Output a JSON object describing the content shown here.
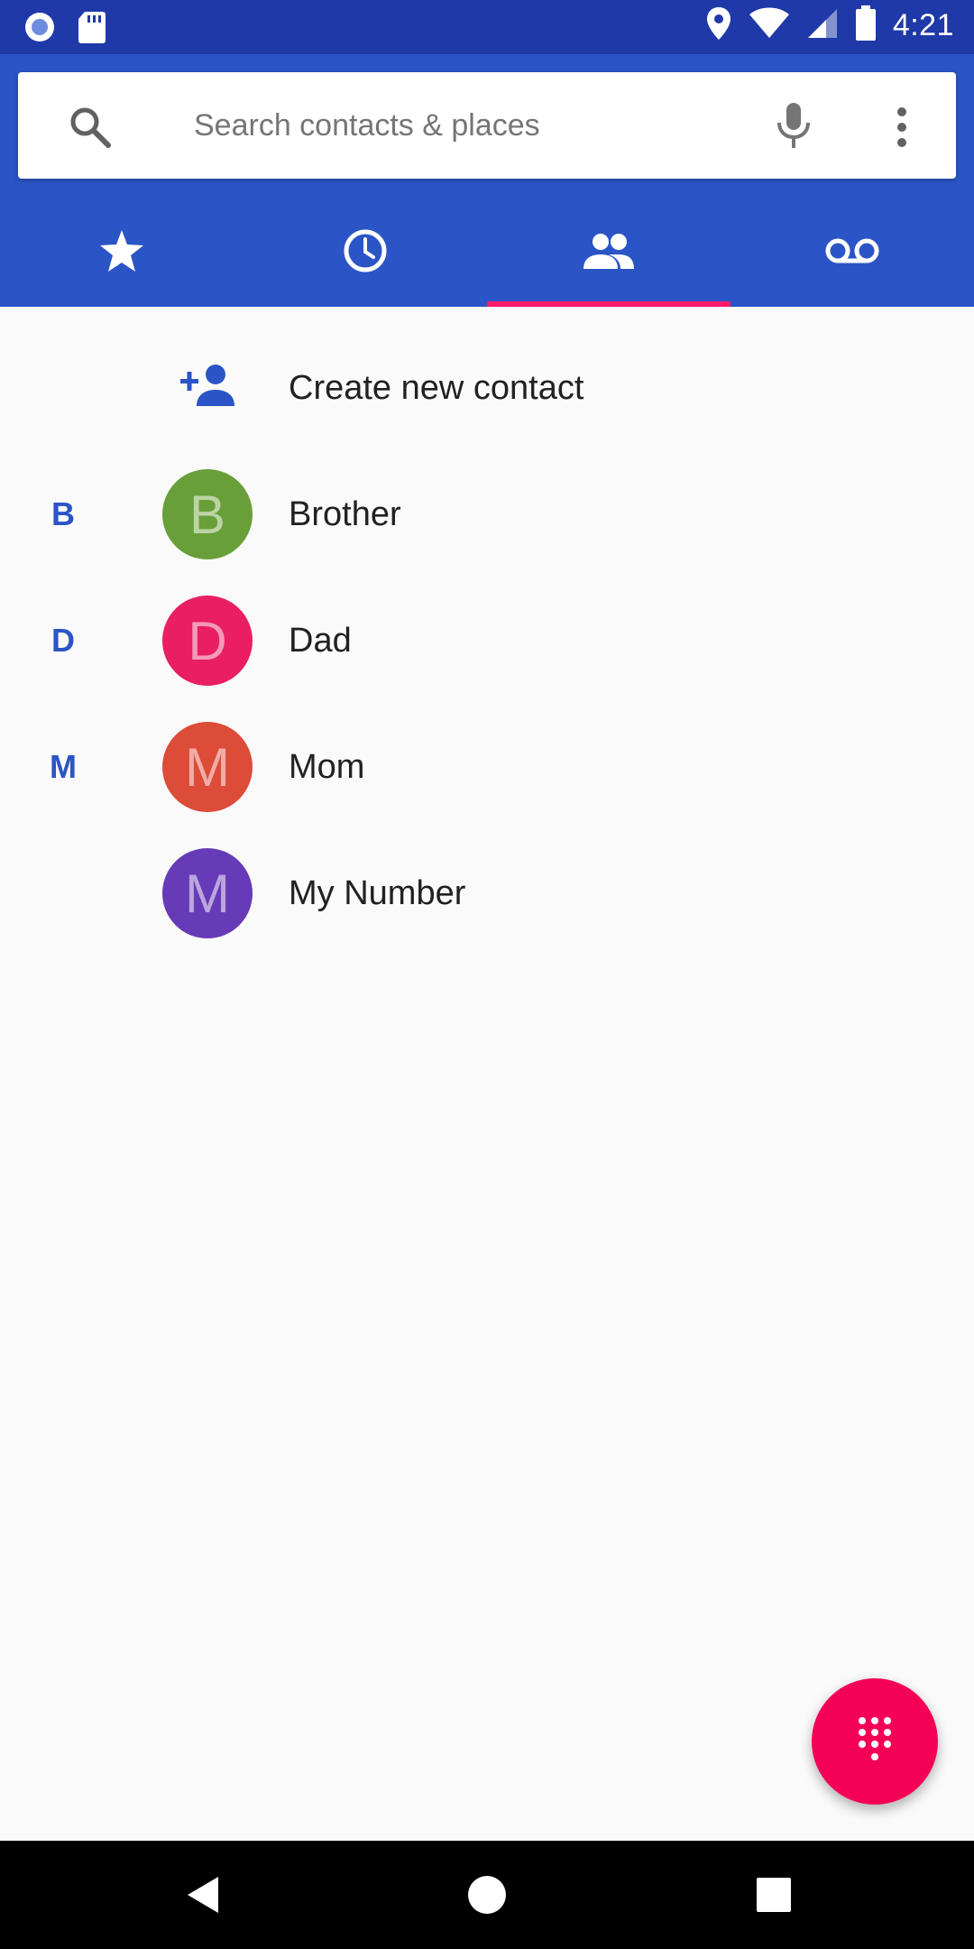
{
  "status_bar": {
    "time": "4:21",
    "icons": [
      "assistant-icon",
      "sd-card-icon",
      "location-icon",
      "wifi-icon",
      "signal-icon",
      "battery-icon"
    ]
  },
  "search": {
    "placeholder": "Search contacts & places",
    "icons": [
      "search-icon",
      "mic-icon",
      "more-vert-icon"
    ]
  },
  "tabs": [
    {
      "icon": "star-icon",
      "name": "Favorites",
      "selected": false
    },
    {
      "icon": "clock-icon",
      "name": "Recents",
      "selected": false
    },
    {
      "icon": "people-icon",
      "name": "Contacts",
      "selected": true
    },
    {
      "icon": "voicemail-icon",
      "name": "Voicemail",
      "selected": false
    }
  ],
  "create_contact": {
    "label": "Create new contact",
    "icon": "add-person-icon"
  },
  "contacts": [
    {
      "section": "B",
      "initial": "B",
      "name": "Brother",
      "color": "#689f38"
    },
    {
      "section": "D",
      "initial": "D",
      "name": "Dad",
      "color": "#e91e63"
    },
    {
      "section": "M",
      "initial": "M",
      "name": "Mom",
      "color": "#dd4b39"
    },
    {
      "section": "",
      "initial": "M",
      "name": "My Number",
      "color": "#673ab7"
    }
  ],
  "fab": {
    "icon": "dialpad-icon"
  },
  "nav": {
    "icons": [
      "back-icon",
      "home-icon",
      "recents-icon"
    ]
  },
  "colors": {
    "status_bar": "#1f39a8",
    "header": "#2b55c6",
    "accent": "#f50057",
    "tab_indicator": "#ff1a6c"
  }
}
